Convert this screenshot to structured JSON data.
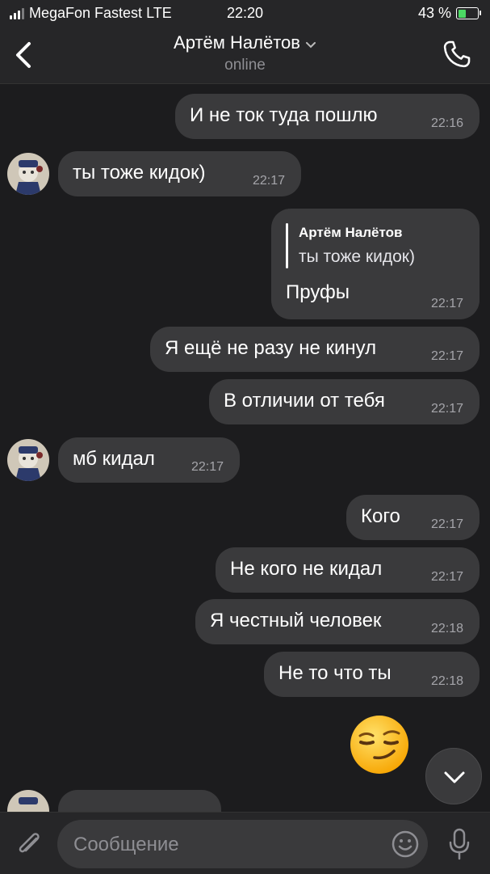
{
  "status_bar": {
    "carrier": "MegaFon Fastest LTE",
    "time": "22:20",
    "battery": "43 %",
    "battery_level": 0.43
  },
  "header": {
    "contact_name": "Артём Налётов",
    "status": "online"
  },
  "messages": [
    {
      "text": "И не ток туда пошлю",
      "time": "22:16",
      "outgoing": true
    },
    {
      "text": "ты тоже кидок)",
      "time": "22:17",
      "outgoing": false
    },
    {
      "reply_to": {
        "name": "Артём Налётов",
        "text": "ты тоже кидок)"
      },
      "text": "Пруфы",
      "time": "22:17",
      "outgoing": true
    },
    {
      "text": "Я ещё не разу не кинул",
      "time": "22:17",
      "outgoing": true
    },
    {
      "text": "В отличии от тебя",
      "time": "22:17",
      "outgoing": true
    },
    {
      "text": "мб кидал",
      "time": "22:17",
      "outgoing": false
    },
    {
      "text": "Кого",
      "time": "22:17",
      "outgoing": true
    },
    {
      "text": "Не кого не кидал",
      "time": "22:17",
      "outgoing": true
    },
    {
      "text": "Я честный человек",
      "time": "22:18",
      "outgoing": true
    },
    {
      "text": "Не то что ты",
      "time": "22:18",
      "outgoing": true
    },
    {
      "emoji": "smirking-face",
      "outgoing": true
    }
  ],
  "composer": {
    "placeholder": "Сообщение"
  },
  "colors": {
    "background": "#1c1c1e",
    "bubble": "#3a3a3c",
    "header": "#262628",
    "battery_fill": "#4cd964"
  }
}
